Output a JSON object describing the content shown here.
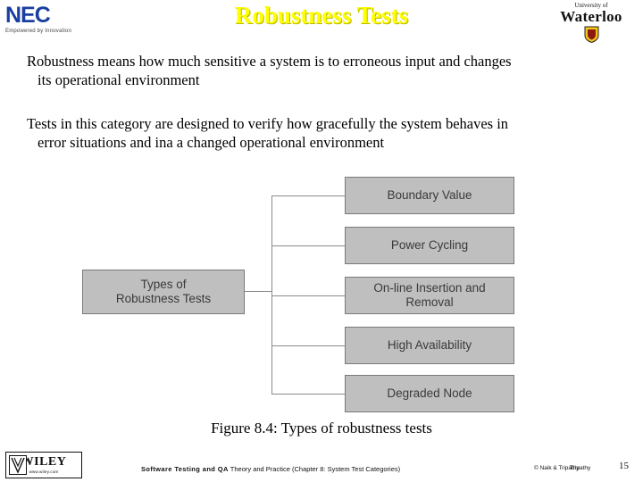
{
  "header": {
    "nec_logo_word": "NEC",
    "nec_tagline": "Empowered by Innovation",
    "title": "Robustness Tests",
    "uw_line1": "University of",
    "uw_line2": "Waterloo"
  },
  "body": {
    "paragraph_1_line_1": "Robustness means how much sensitive a system is to erroneous input and changes",
    "paragraph_1_line_2": "its operational environment",
    "paragraph_2_line_1": "Tests in this category are designed to verify how gracefully the system behaves in",
    "paragraph_2_line_2": "error situations and ina a changed operational environment"
  },
  "diagram": {
    "root": "Types of\nRobustness Tests",
    "root_line_1": "Types of",
    "root_line_2": "Robustness Tests",
    "leaves": [
      {
        "label": "Boundary Value"
      },
      {
        "label": "Power Cycling"
      },
      {
        "label": "On-line Insertion and\nRemoval"
      },
      {
        "label": "High Availability"
      },
      {
        "label": "Degraded Node"
      }
    ],
    "caption": "Figure 8.4: Types of robustness tests"
  },
  "footer": {
    "wiley_name": "WILEY",
    "wiley_sub": "www.wiley.com",
    "source_bold": "Software Testing and QA",
    "source_rest": "Theory and Practice (Chapter 8: System Test Categories)",
    "copyright": "© Naik & Tripathy",
    "copyright_overlap": "Tripathy",
    "page_number": "15"
  },
  "colors": {
    "title": "#ffff00",
    "node_fill": "#bfbfbf",
    "node_border": "#7a7a7a",
    "nec_blue": "#1b3fa0"
  }
}
